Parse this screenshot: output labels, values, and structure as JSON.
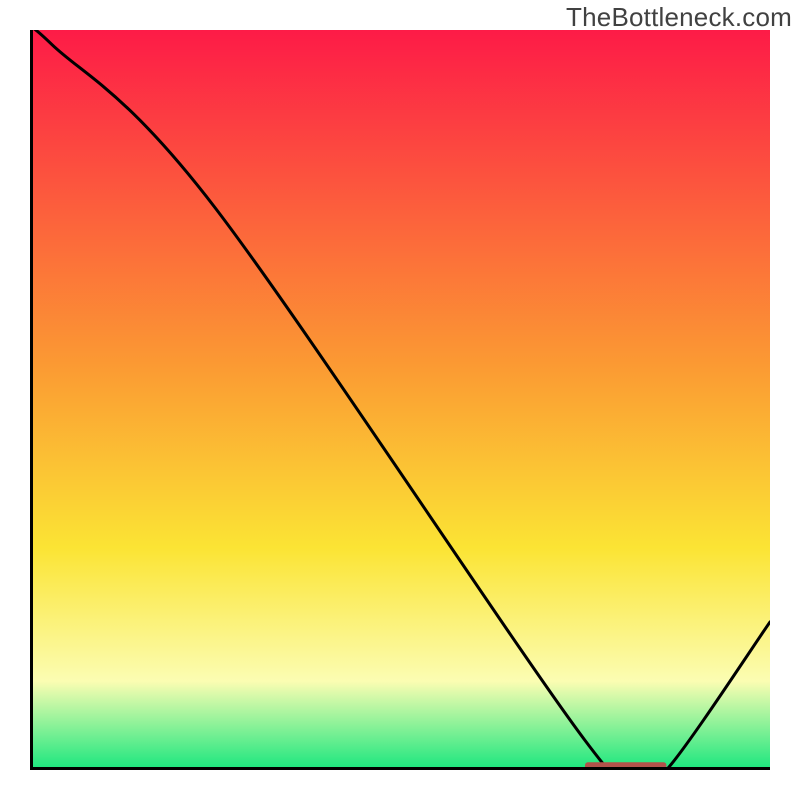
{
  "watermark_text": "TheBottleneck.com",
  "colors": {
    "grad_top": "#fd1b47",
    "grad_mid1": "#fb9933",
    "grad_mid2": "#fbe434",
    "grad_mid3": "#fbfdb2",
    "grad_bottom": "#19e67e",
    "curve": "#000000",
    "marker": "#b2524b",
    "axis": "#000000"
  },
  "chart_data": {
    "type": "line",
    "title": "",
    "xlabel": "",
    "ylabel": "",
    "xlim": [
      0,
      100
    ],
    "ylim": [
      0,
      100
    ],
    "x": [
      0,
      3,
      25,
      75,
      82,
      86,
      100
    ],
    "y": [
      100,
      98,
      76,
      4,
      0,
      0,
      20
    ],
    "marker": {
      "x_from": 75,
      "x_to": 86,
      "y": 0.5,
      "color": "#b2524b"
    },
    "gradient_direction": "vertical",
    "gradient_stops": [
      {
        "pos": 0.0,
        "color": "#fd1b47"
      },
      {
        "pos": 0.45,
        "color": "#fb9933"
      },
      {
        "pos": 0.7,
        "color": "#fbe434"
      },
      {
        "pos": 0.88,
        "color": "#fbfdb2"
      },
      {
        "pos": 1.0,
        "color": "#19e67e"
      }
    ]
  }
}
